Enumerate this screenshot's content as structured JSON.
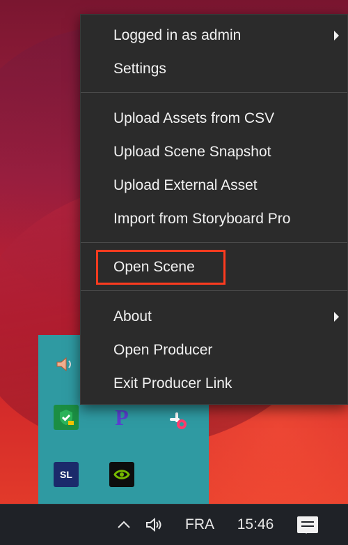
{
  "menu": {
    "items": [
      {
        "label": "Logged in as admin",
        "submenu": true
      },
      {
        "label": "Settings",
        "submenu": false
      },
      {
        "label": "Upload Assets from CSV",
        "submenu": false
      },
      {
        "label": "Upload Scene Snapshot",
        "submenu": false
      },
      {
        "label": "Upload External Asset",
        "submenu": false
      },
      {
        "label": "Import from Storyboard Pro",
        "submenu": false
      },
      {
        "label": "Open Scene",
        "submenu": false,
        "highlighted": true
      },
      {
        "label": "About",
        "submenu": true
      },
      {
        "label": "Open Producer",
        "submenu": false
      },
      {
        "label": "Exit Producer Link",
        "submenu": false
      }
    ],
    "highlight_color": "#ff3b1f"
  },
  "tray": {
    "icons": [
      {
        "name": "speaker-icon"
      },
      {
        "name": "shield-check-icon"
      },
      {
        "name": "p-app-icon"
      },
      {
        "name": "slack-icon"
      },
      {
        "name": "sl-app-icon",
        "label": "SL"
      },
      {
        "name": "nvidia-icon"
      }
    ]
  },
  "taskbar": {
    "chevron": "^",
    "language": "FRA",
    "time": "15:46",
    "icons": [
      "chevron-up-icon",
      "volume-icon",
      "notification-icon"
    ]
  }
}
